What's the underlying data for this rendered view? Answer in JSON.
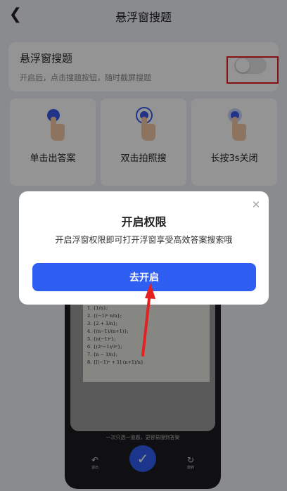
{
  "nav": {
    "title": "悬浮窗搜题",
    "back_icon": "chevron-left-icon"
  },
  "toggle_card": {
    "title": "悬浮窗搜题",
    "subtitle": "开启后，点击搜题按钮，随时截屏搜题",
    "enabled": false
  },
  "features": [
    {
      "label": "单击出答案",
      "icon": "single-tap-icon"
    },
    {
      "label": "双击拍照搜",
      "icon": "double-tap-icon"
    },
    {
      "label": "长按3s关闭",
      "icon": "long-press-icon"
    }
  ],
  "phone": {
    "math_lines": [
      "1. {1/n};",
      "2. {(−1)ⁿ n/n};",
      "3. {2 + 1/n};",
      "4. {(n−1)/(n+1)};",
      "5. {n(−1)ⁿ};",
      "6. {(2ⁿ−1)/3ⁿ};",
      "7. {n − 1/n};",
      "8. {[(−1)ⁿ + 1] (n+1)/n}"
    ],
    "hint": "一次只选一道题，更容易搜到答案",
    "left_button": "退出",
    "right_button": "旋转"
  },
  "dialog": {
    "title": "开启权限",
    "message": "开启浮窗权限即可打开浮窗享受高效答案搜索哦",
    "button_label": "去开启"
  },
  "colors": {
    "accent": "#2f5ef2",
    "highlight": "#e52020"
  }
}
